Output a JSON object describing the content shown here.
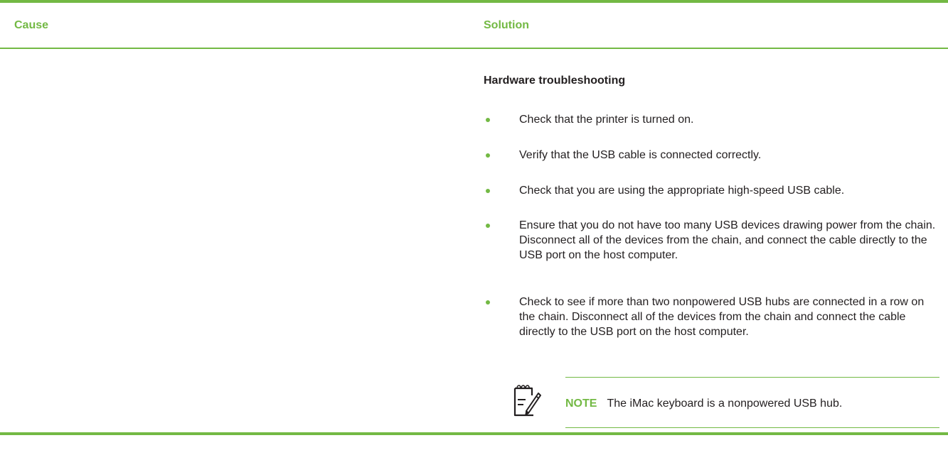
{
  "table": {
    "headers": {
      "cause": "Cause",
      "solution": "Solution"
    },
    "solution": {
      "heading": "Hardware troubleshooting",
      "bullets": [
        {
          "text": "Check that the printer is turned on."
        },
        {
          "text": "Verify that the USB cable is connected correctly."
        },
        {
          "text": "Check that you are using the appropriate high-speed USB cable."
        },
        {
          "text": "Ensure that you do not have too many USB devices drawing power from the chain. Disconnect all of the devices from the chain, and connect the cable directly to the USB port on the host computer."
        },
        {
          "text": "Check to see if more than two nonpowered USB hubs are connected in a row on the chain. Disconnect all of the devices from the chain and connect the cable directly to the USB port on the host computer."
        }
      ],
      "note": {
        "icon": "note-pencil-icon",
        "label": "NOTE",
        "text": "The iMac keyboard is a nonpowered USB hub."
      }
    }
  },
  "colors": {
    "accent": "#73b944",
    "text": "#231f20"
  }
}
